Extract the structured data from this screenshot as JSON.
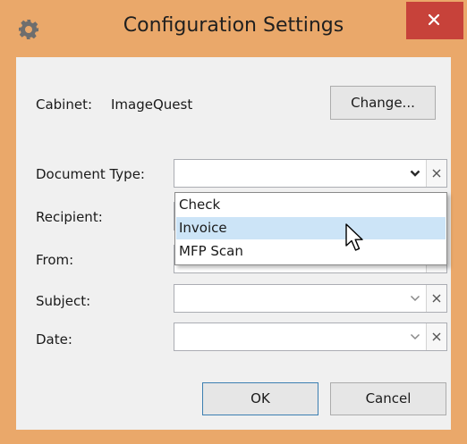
{
  "window": {
    "title": "Configuration Settings",
    "icons": {
      "app": "gear-icon",
      "close": "close-icon"
    }
  },
  "cabinet": {
    "label": "Cabinet:",
    "value": "ImageQuest",
    "change_button": "Change..."
  },
  "fields": [
    {
      "label": "Document Type:",
      "value": ""
    },
    {
      "label": "Recipient:",
      "value": ""
    },
    {
      "label": "From:",
      "value": ""
    },
    {
      "label": "Subject:",
      "value": ""
    },
    {
      "label": "Date:",
      "value": ""
    }
  ],
  "dropdown": {
    "options": [
      "Check",
      "Invoice",
      "MFP Scan"
    ],
    "highlighted": "Invoice"
  },
  "buttons": {
    "ok": "OK",
    "cancel": "Cancel"
  },
  "colors": {
    "frame": "#eaa86a",
    "close": "#c7423a",
    "highlight": "#cce4f7"
  }
}
